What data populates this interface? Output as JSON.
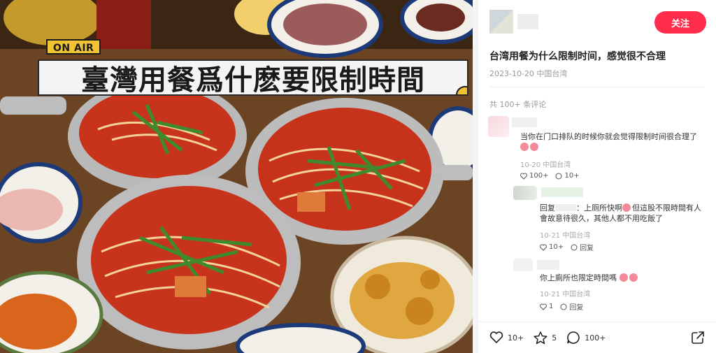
{
  "photo": {
    "badge": "ON AIR",
    "headline": "臺灣用餐爲什麽要限制時間"
  },
  "post": {
    "follow_label": "关注",
    "title": "台湾用餐为什么限制时间，感觉很不合理",
    "meta": "2023-10-20 中国台湾",
    "comment_count": "共 100+ 条评论"
  },
  "comments": [
    {
      "text": "当你在门口排队的时候你就会觉得限制时间很合理了",
      "date": "10-20 中国台湾",
      "likes": "100+",
      "replies": "10+"
    },
    {
      "reply_prefix": "回复",
      "text": "：上厕所快啊",
      "text2": "但這股不限時間有人會故意待很久，其他人都不用吃飯了",
      "date": "10-21 中国台湾",
      "likes": "10+",
      "reply_label": "回复"
    },
    {
      "text": "你上廁所也限定時間嗎",
      "date": "10-21 中国台湾",
      "likes": "1",
      "reply_label": "回复"
    }
  ],
  "bottom": {
    "likes": "10+",
    "favorites": "5",
    "comments": "100+"
  },
  "colors": {
    "accent": "#ff2e4d",
    "on_air": "#f1c232"
  }
}
